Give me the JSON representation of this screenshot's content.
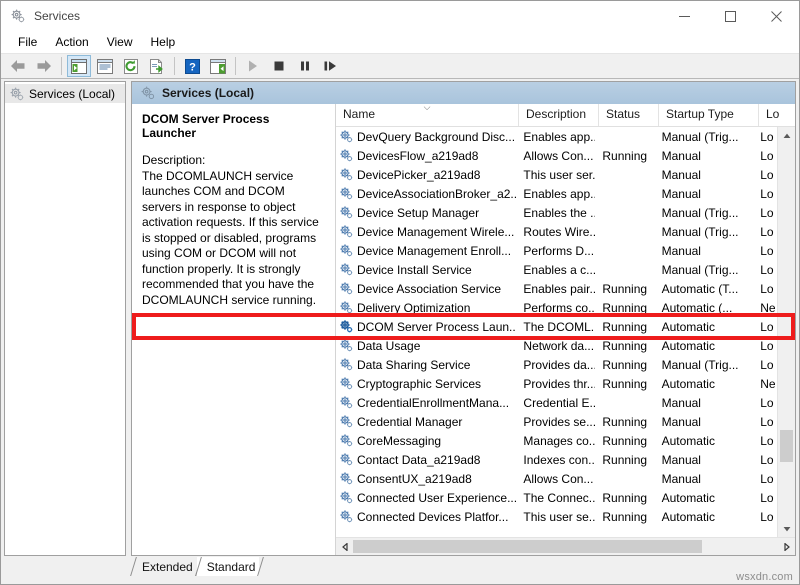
{
  "window": {
    "title": "Services",
    "icon": "services-gear-icon",
    "buttons": {
      "minimize": "—",
      "maximize": "□",
      "close": "✕"
    }
  },
  "menubar": {
    "items": [
      {
        "label": "File"
      },
      {
        "label": "Action"
      },
      {
        "label": "View"
      },
      {
        "label": "Help"
      }
    ]
  },
  "toolbar": {
    "buttons": [
      {
        "name": "back-icon"
      },
      {
        "name": "forward-icon"
      },
      {
        "name": "show-hide-console-tree-icon"
      },
      {
        "name": "properties-icon"
      },
      {
        "name": "refresh-icon"
      },
      {
        "name": "export-list-icon"
      },
      {
        "name": "help-icon"
      },
      {
        "name": "show-hide-action-pane-icon"
      },
      {
        "name": "start-service-icon"
      },
      {
        "name": "stop-service-icon"
      },
      {
        "name": "pause-service-icon"
      },
      {
        "name": "restart-service-icon"
      }
    ]
  },
  "tree": {
    "root": "Services (Local)"
  },
  "pane": {
    "header": "Services (Local)"
  },
  "detail": {
    "title": "DCOM Server Process Launcher",
    "description_label": "Description:",
    "description_body": "The DCOMLAUNCH service launches COM and DCOM servers in response to object activation requests. If this service is stopped or disabled, programs using COM or DCOM will not function properly. It is strongly recommended that you have the DCOMLAUNCH service running."
  },
  "list": {
    "columns": [
      {
        "key": "name",
        "label": "Name",
        "sorted": true
      },
      {
        "key": "desc",
        "label": "Description"
      },
      {
        "key": "status",
        "label": "Status"
      },
      {
        "key": "startup",
        "label": "Startup Type"
      },
      {
        "key": "logon",
        "label": "Lo"
      }
    ],
    "rows": [
      {
        "name": "DevQuery Background Disc...",
        "desc": "Enables app...",
        "status": "",
        "startup": "Manual (Trig...",
        "logon": "Lo",
        "highlight": false
      },
      {
        "name": "DevicesFlow_a219ad8",
        "desc": "Allows Con...",
        "status": "Running",
        "startup": "Manual",
        "logon": "Lo",
        "highlight": false
      },
      {
        "name": "DevicePicker_a219ad8",
        "desc": "This user ser...",
        "status": "",
        "startup": "Manual",
        "logon": "Lo",
        "highlight": false
      },
      {
        "name": "DeviceAssociationBroker_a2...",
        "desc": "Enables app...",
        "status": "",
        "startup": "Manual",
        "logon": "Lo",
        "highlight": false
      },
      {
        "name": "Device Setup Manager",
        "desc": "Enables the ...",
        "status": "",
        "startup": "Manual (Trig...",
        "logon": "Lo",
        "highlight": false
      },
      {
        "name": "Device Management Wirele...",
        "desc": "Routes Wire...",
        "status": "",
        "startup": "Manual (Trig...",
        "logon": "Lo",
        "highlight": false
      },
      {
        "name": "Device Management Enroll...",
        "desc": "Performs D...",
        "status": "",
        "startup": "Manual",
        "logon": "Lo",
        "highlight": false
      },
      {
        "name": "Device Install Service",
        "desc": "Enables a c...",
        "status": "",
        "startup": "Manual (Trig...",
        "logon": "Lo",
        "highlight": false
      },
      {
        "name": "Device Association Service",
        "desc": "Enables pair...",
        "status": "Running",
        "startup": "Automatic (T...",
        "logon": "Lo",
        "highlight": false
      },
      {
        "name": "Delivery Optimization",
        "desc": "Performs co...",
        "status": "Running",
        "startup": "Automatic (...",
        "logon": "Ne",
        "highlight": false
      },
      {
        "name": "DCOM Server Process Laun...",
        "desc": "The DCOML...",
        "status": "Running",
        "startup": "Automatic",
        "logon": "Lo",
        "highlight": true
      },
      {
        "name": "Data Usage",
        "desc": "Network da...",
        "status": "Running",
        "startup": "Automatic",
        "logon": "Lo",
        "highlight": false
      },
      {
        "name": "Data Sharing Service",
        "desc": "Provides da...",
        "status": "Running",
        "startup": "Manual (Trig...",
        "logon": "Lo",
        "highlight": false
      },
      {
        "name": "Cryptographic Services",
        "desc": "Provides thr...",
        "status": "Running",
        "startup": "Automatic",
        "logon": "Ne",
        "highlight": false
      },
      {
        "name": "CredentialEnrollmentMana...",
        "desc": "Credential E...",
        "status": "",
        "startup": "Manual",
        "logon": "Lo",
        "highlight": false
      },
      {
        "name": "Credential Manager",
        "desc": "Provides se...",
        "status": "Running",
        "startup": "Manual",
        "logon": "Lo",
        "highlight": false
      },
      {
        "name": "CoreMessaging",
        "desc": "Manages co...",
        "status": "Running",
        "startup": "Automatic",
        "logon": "Lo",
        "highlight": false
      },
      {
        "name": "Contact Data_a219ad8",
        "desc": "Indexes con...",
        "status": "Running",
        "startup": "Manual",
        "logon": "Lo",
        "highlight": false
      },
      {
        "name": "ConsentUX_a219ad8",
        "desc": "Allows Con...",
        "status": "",
        "startup": "Manual",
        "logon": "Lo",
        "highlight": false
      },
      {
        "name": "Connected User Experience...",
        "desc": "The Connec...",
        "status": "Running",
        "startup": "Automatic",
        "logon": "Lo",
        "highlight": false
      },
      {
        "name": "Connected Devices Platfor...",
        "desc": "This user se...",
        "status": "Running",
        "startup": "Automatic",
        "logon": "Lo",
        "highlight": false
      }
    ],
    "scroll_up": "ⱏ",
    "scroll_down": "ⱟ",
    "scroll_left": "‹",
    "scroll_right": "›"
  },
  "tabs": [
    {
      "label": "Extended",
      "selected": false
    },
    {
      "label": "Standard",
      "selected": true
    }
  ],
  "watermark": "wsxdn.com",
  "colors": {
    "highlight_red": "#ee1c1c",
    "pane_header": "#aec6dd",
    "accent_blue": "#2a6fb5"
  }
}
